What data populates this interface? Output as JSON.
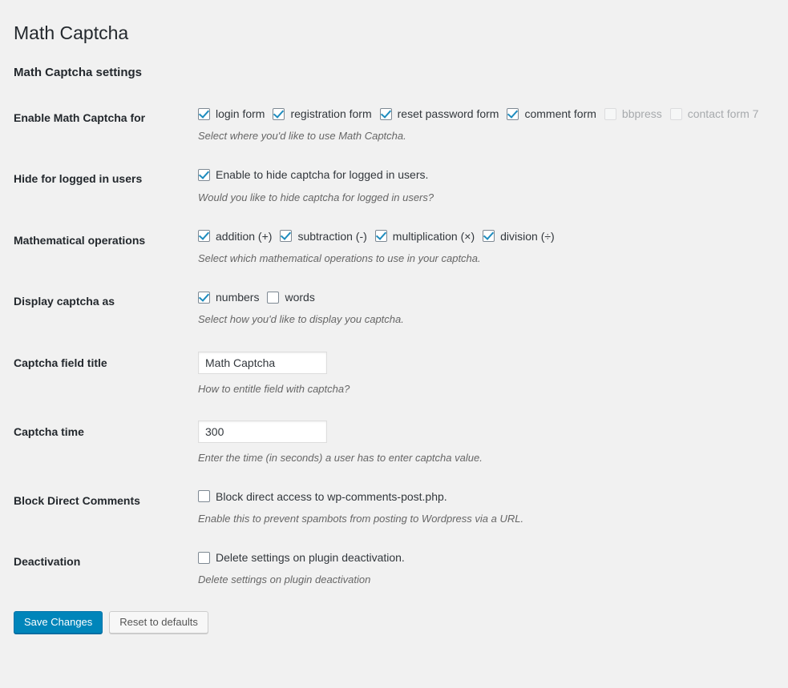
{
  "page": {
    "title": "Math Captcha",
    "section_title": "Math Captcha settings"
  },
  "settings": {
    "enable_for": {
      "label": "Enable Math Captcha for",
      "description": "Select where you'd like to use Math Captcha.",
      "options": [
        {
          "label": "login form",
          "checked": true,
          "disabled": false
        },
        {
          "label": "registration form",
          "checked": true,
          "disabled": false
        },
        {
          "label": "reset password form",
          "checked": true,
          "disabled": false
        },
        {
          "label": "comment form",
          "checked": true,
          "disabled": false
        },
        {
          "label": "bbpress",
          "checked": false,
          "disabled": true
        },
        {
          "label": "contact form 7",
          "checked": false,
          "disabled": true
        }
      ]
    },
    "hide_logged_in": {
      "label": "Hide for logged in users",
      "description": "Would you like to hide captcha for logged in users?",
      "options": [
        {
          "label": "Enable to hide captcha for logged in users.",
          "checked": true,
          "disabled": false
        }
      ]
    },
    "operations": {
      "label": "Mathematical operations",
      "description": "Select which mathematical operations to use in your captcha.",
      "options": [
        {
          "label": "addition (+)",
          "checked": true,
          "disabled": false
        },
        {
          "label": "subtraction (-)",
          "checked": true,
          "disabled": false
        },
        {
          "label": "multiplication (×)",
          "checked": true,
          "disabled": false
        },
        {
          "label": "division (÷)",
          "checked": true,
          "disabled": false
        }
      ]
    },
    "display_as": {
      "label": "Display captcha as",
      "description": "Select how you'd like to display you captcha.",
      "options": [
        {
          "label": "numbers",
          "checked": true,
          "disabled": false
        },
        {
          "label": "words",
          "checked": false,
          "disabled": false
        }
      ]
    },
    "field_title": {
      "label": "Captcha field title",
      "description": "How to entitle field with captcha?",
      "value": "Math Captcha"
    },
    "captcha_time": {
      "label": "Captcha time",
      "description": "Enter the time (in seconds) a user has to enter captcha value.",
      "value": "300"
    },
    "block_direct": {
      "label": "Block Direct Comments",
      "description": "Enable this to prevent spambots from posting to Wordpress via a URL.",
      "options": [
        {
          "label": "Block direct access to wp-comments-post.php.",
          "checked": false,
          "disabled": false
        }
      ]
    },
    "deactivation": {
      "label": "Deactivation",
      "description": "Delete settings on plugin deactivation",
      "options": [
        {
          "label": "Delete settings on plugin deactivation.",
          "checked": false,
          "disabled": false
        }
      ]
    }
  },
  "actions": {
    "save_label": "Save Changes",
    "reset_label": "Reset to defaults"
  },
  "colors": {
    "background": "#f1f1f1",
    "primary_button": "#0085ba",
    "checkmark": "#1e8cbe",
    "heading": "#23282d",
    "description": "#666666",
    "disabled_text": "#a7aaad"
  }
}
